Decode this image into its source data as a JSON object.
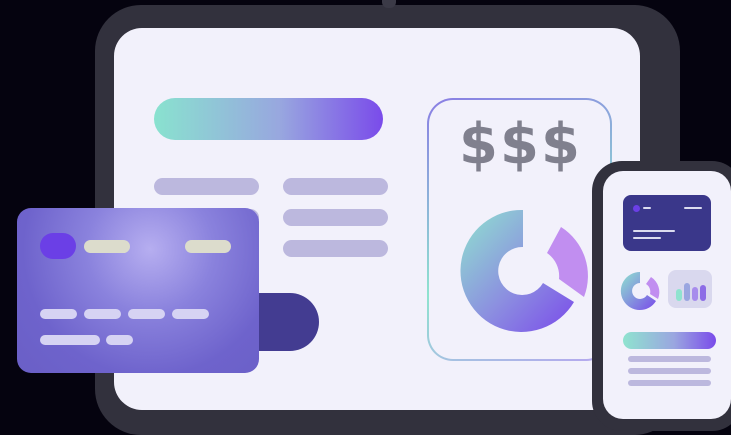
{
  "illustration": {
    "money_label": "$$$",
    "colors": {
      "background": "#05030f",
      "device_frame": "#32313d",
      "screen": "#f2f1fb",
      "accent_purple": "#7a4bea",
      "accent_teal": "#89e2cf",
      "placeholder_line": "#bcb8de",
      "dark_navy": "#433c91"
    },
    "icons": [
      "tablet",
      "credit-card",
      "smartphone",
      "donut-chart",
      "bar-chart",
      "dollar-sign"
    ]
  }
}
